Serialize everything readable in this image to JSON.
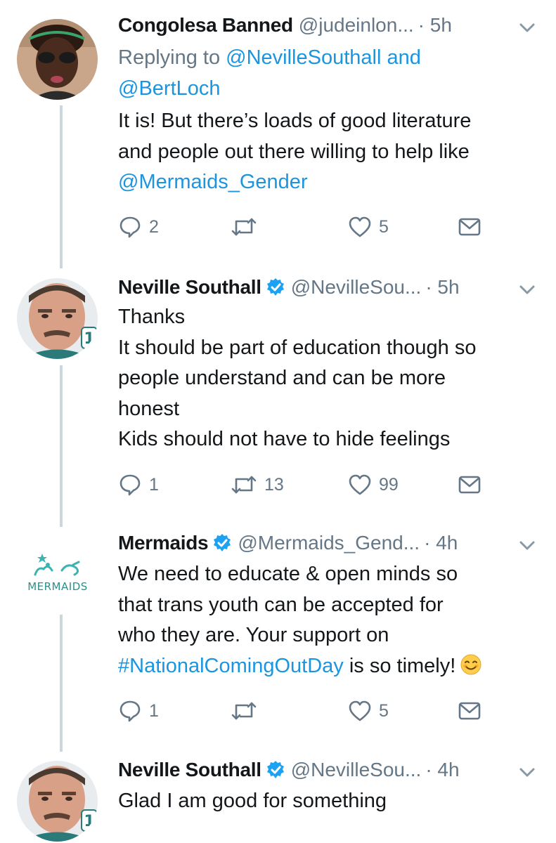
{
  "tweets": [
    {
      "name": "Congolesa Banned",
      "verified": false,
      "handle": "@judeinlon...",
      "time": "· 5h",
      "reply_prefix": "Replying to",
      "reply_to_1": "@NevilleSouthall and",
      "reply_to_2": "@BertLoch",
      "line1": "It is! But there’s loads of good literature",
      "line2": "and people out there willing to help like",
      "line3_link": "@Mermaids_Gender",
      "replies": "2",
      "retweets": "",
      "likes": "5",
      "avatar_icon": "profile-photo-woman-sunglasses"
    },
    {
      "name": "Neville Southall",
      "verified": true,
      "handle": "@NevilleSou...",
      "time": "· 5h",
      "line1": "Thanks",
      "line2": "It should be part of education though so",
      "line3": "people understand and can be more",
      "line4": "honest",
      "line5": "Kids should not have to hide feelings",
      "replies": "1",
      "retweets": "13",
      "likes": "99",
      "avatar_icon": "profile-photo-man-goalkeeper"
    },
    {
      "name": "Mermaids",
      "verified": true,
      "handle": "@Mermaids_Gend...",
      "time": "· 4h",
      "line1": "We need to educate & open minds so",
      "line2": "that trans youth can be accepted for",
      "line3": "who they are. Your support on",
      "line4_link": "#NationalComingOutDay",
      "line4_rest": " is so timely!",
      "emoji": "smiling-face-emoji",
      "replies": "1",
      "retweets": "",
      "likes": "5",
      "logo_text": "MERMAIDS",
      "avatar_icon": "mermaids-logo"
    },
    {
      "name": "Neville Southall",
      "verified": true,
      "handle": "@NevilleSou...",
      "time": "· 4h",
      "line1": "Glad I am good for something",
      "avatar_icon": "profile-photo-man-goalkeeper"
    }
  ],
  "colors": {
    "text": "#14171a",
    "secondary": "#657786",
    "link": "#1b95e0",
    "verified": "#1da1f2",
    "thread_line": "#ccd6dd"
  }
}
